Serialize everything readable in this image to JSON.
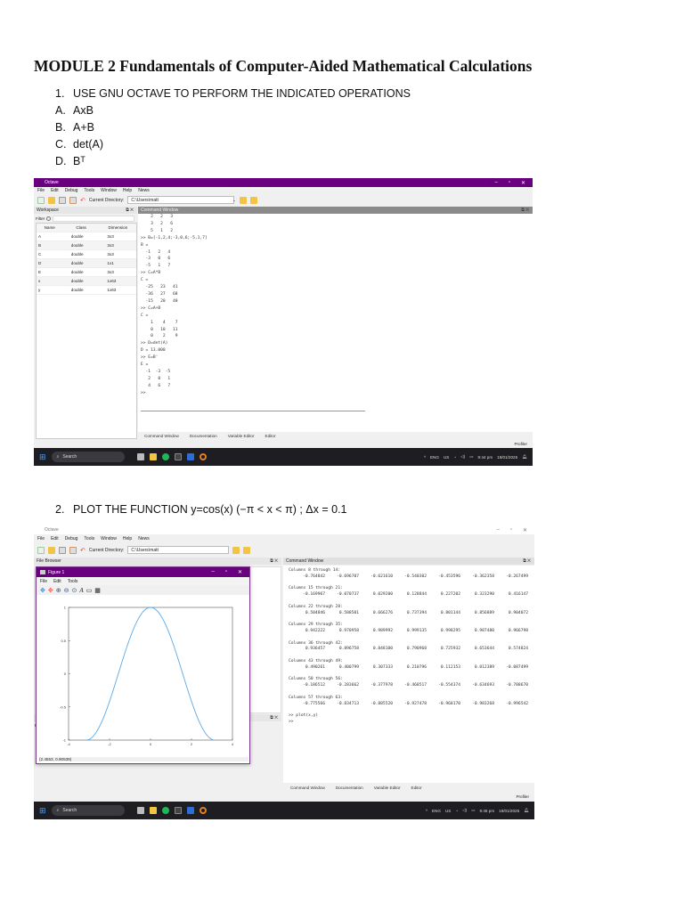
{
  "heading": "MODULE 2 Fundamentals of Computer-Aided Mathematical Calculations",
  "q1": {
    "num": "1.",
    "text": "USE GNU OCTAVE TO PERFORM THE INDICATED OPERATIONS",
    "items": [
      {
        "num": "A.",
        "text": "AxB"
      },
      {
        "num": "B.",
        "text": "A+B"
      },
      {
        "num": "C.",
        "text": "det(A)"
      },
      {
        "num": "D.",
        "text": "Bᵀ"
      }
    ]
  },
  "q2": {
    "num": "2.",
    "text": "PLOT THE FUNCTION y=cos(x)  (−π < x < π)  ; Δx = 0.1"
  },
  "octave": {
    "title": "Octave",
    "menu": [
      "File",
      "Edit",
      "Debug",
      "Tools",
      "Window",
      "Help",
      "News"
    ],
    "dir_label": "Current Directory:",
    "dir_value": "C:\\Users\\matt"
  },
  "shot1": {
    "workspace_title": "Workspace",
    "filter_label": "Filter",
    "cmd_title": "Command Window",
    "ws_headers": [
      "Name",
      "Class",
      "Dimension"
    ],
    "ws_rows": [
      [
        "A",
        "double",
        "3x3"
      ],
      [
        "B",
        "double",
        "3x3"
      ],
      [
        "C",
        "double",
        "3x3"
      ],
      [
        "D",
        "double",
        "1x1"
      ],
      [
        "E",
        "double",
        "3x3"
      ],
      [
        "x",
        "double",
        "1x63"
      ],
      [
        "y",
        "double",
        "1x63"
      ]
    ],
    "cmd_lines": [
      "    2   2   3",
      "    3   2   6",
      "    5   1   2",
      "",
      ">> B=[-1,2,4;-3,0,6;-5,1,7]",
      "B =",
      "",
      "  -1   2   4",
      "  -3   0   6",
      "  -5   1   7",
      "",
      ">> C=A*B",
      "C =",
      "",
      "  -25   23   41",
      "  -36   27   68",
      "  -15   20   40",
      "",
      ">> C=A+B",
      "C =",
      "",
      "    1    4    7",
      "    0   10   11",
      "    0    2    9",
      "",
      ">> D=det(A)",
      "D = 13.000",
      ">> E=B'",
      "E =",
      "",
      "  -1  -3  -5",
      "   2   0   1",
      "   4   6   7",
      "",
      ">>"
    ],
    "tabs": [
      "Command Window",
      "Documentation",
      "Variable Editor",
      "Editor"
    ],
    "profiler": "Profiler",
    "clock": {
      "time": "9:44 pm",
      "date": "18/01/2025"
    }
  },
  "shot2": {
    "file_browser_title": "File Browser",
    "cmd_title": "Command Window",
    "ws_short": "Wo",
    "filter_short": "Filte",
    "figure": {
      "title": "Figure 1",
      "menu": [
        "File",
        "Edit",
        "Tools"
      ],
      "status": "(2.4553, 0.90539)"
    },
    "blocks": [
      {
        "header": "Columns 8 through 14:",
        "values": [
          "-0.764842",
          "-0.696707",
          "-0.621610",
          "-0.540302",
          "-0.453596",
          "-0.362358",
          "-0.267499"
        ]
      },
      {
        "header": "Columns 15 through 21:",
        "values": [
          "-0.169967",
          "-0.070737",
          "0.029200",
          "0.128844",
          "0.227202",
          "0.323290",
          "0.416147"
        ]
      },
      {
        "header": "Columns 22 through 28:",
        "values": [
          "0.504846",
          "0.588501",
          "0.666276",
          "0.737394",
          "0.801144",
          "0.856889",
          "0.904072"
        ]
      },
      {
        "header": "Columns 29 through 35:",
        "values": [
          "0.942222",
          "0.970958",
          "0.989992",
          "0.999135",
          "0.998295",
          "0.987480",
          "0.966798"
        ]
      },
      {
        "header": "Columns 36 through 42:",
        "values": [
          "0.936457",
          "0.896758",
          "0.848100",
          "0.790968",
          "0.725932",
          "0.653644",
          "0.574824"
        ]
      },
      {
        "header": "Columns 43 through 49:",
        "values": [
          "0.490261",
          "0.400799",
          "0.307333",
          "0.210796",
          "0.112153",
          "0.012389",
          "-0.087499"
        ]
      },
      {
        "header": "Columns 50 through 56:",
        "values": [
          "-0.186512",
          "-0.283662",
          "-0.377978",
          "-0.468517",
          "-0.554374",
          "-0.634693",
          "-0.708670"
        ]
      },
      {
        "header": "Columns 57 through 63:",
        "values": [
          "-0.775566",
          "-0.834713",
          "-0.885520",
          "-0.927478",
          "-0.960170",
          "-0.983268",
          "-0.996542"
        ]
      }
    ],
    "prompt_lines": [
      ">> plot(x,y)",
      ">> "
    ],
    "tabs": [
      "Command Window",
      "Documentation",
      "Variable Editor",
      "Editor"
    ],
    "profiler": "Profiler",
    "clock": {
      "time": "9:46 pm",
      "date": "18/01/2025"
    }
  },
  "taskbar": {
    "search": "Search",
    "lang": "ENG",
    "region": "US"
  },
  "colors": {
    "purple": "#6a0080",
    "curve": "#5aa9e6"
  },
  "chart_data": {
    "type": "line",
    "title": "",
    "xlabel": "",
    "ylabel": "",
    "function": "y=cos(x)",
    "x_range": [
      -3.1416,
      3.1416
    ],
    "step": 0.1,
    "xlim": [
      -4,
      4
    ],
    "ylim": [
      -1,
      1
    ],
    "xticks": [
      "-4",
      "-2",
      "0",
      "2",
      "4"
    ],
    "yticks": [
      "1",
      "0.5",
      "0",
      "-0.5",
      "-1"
    ],
    "grid": false
  }
}
